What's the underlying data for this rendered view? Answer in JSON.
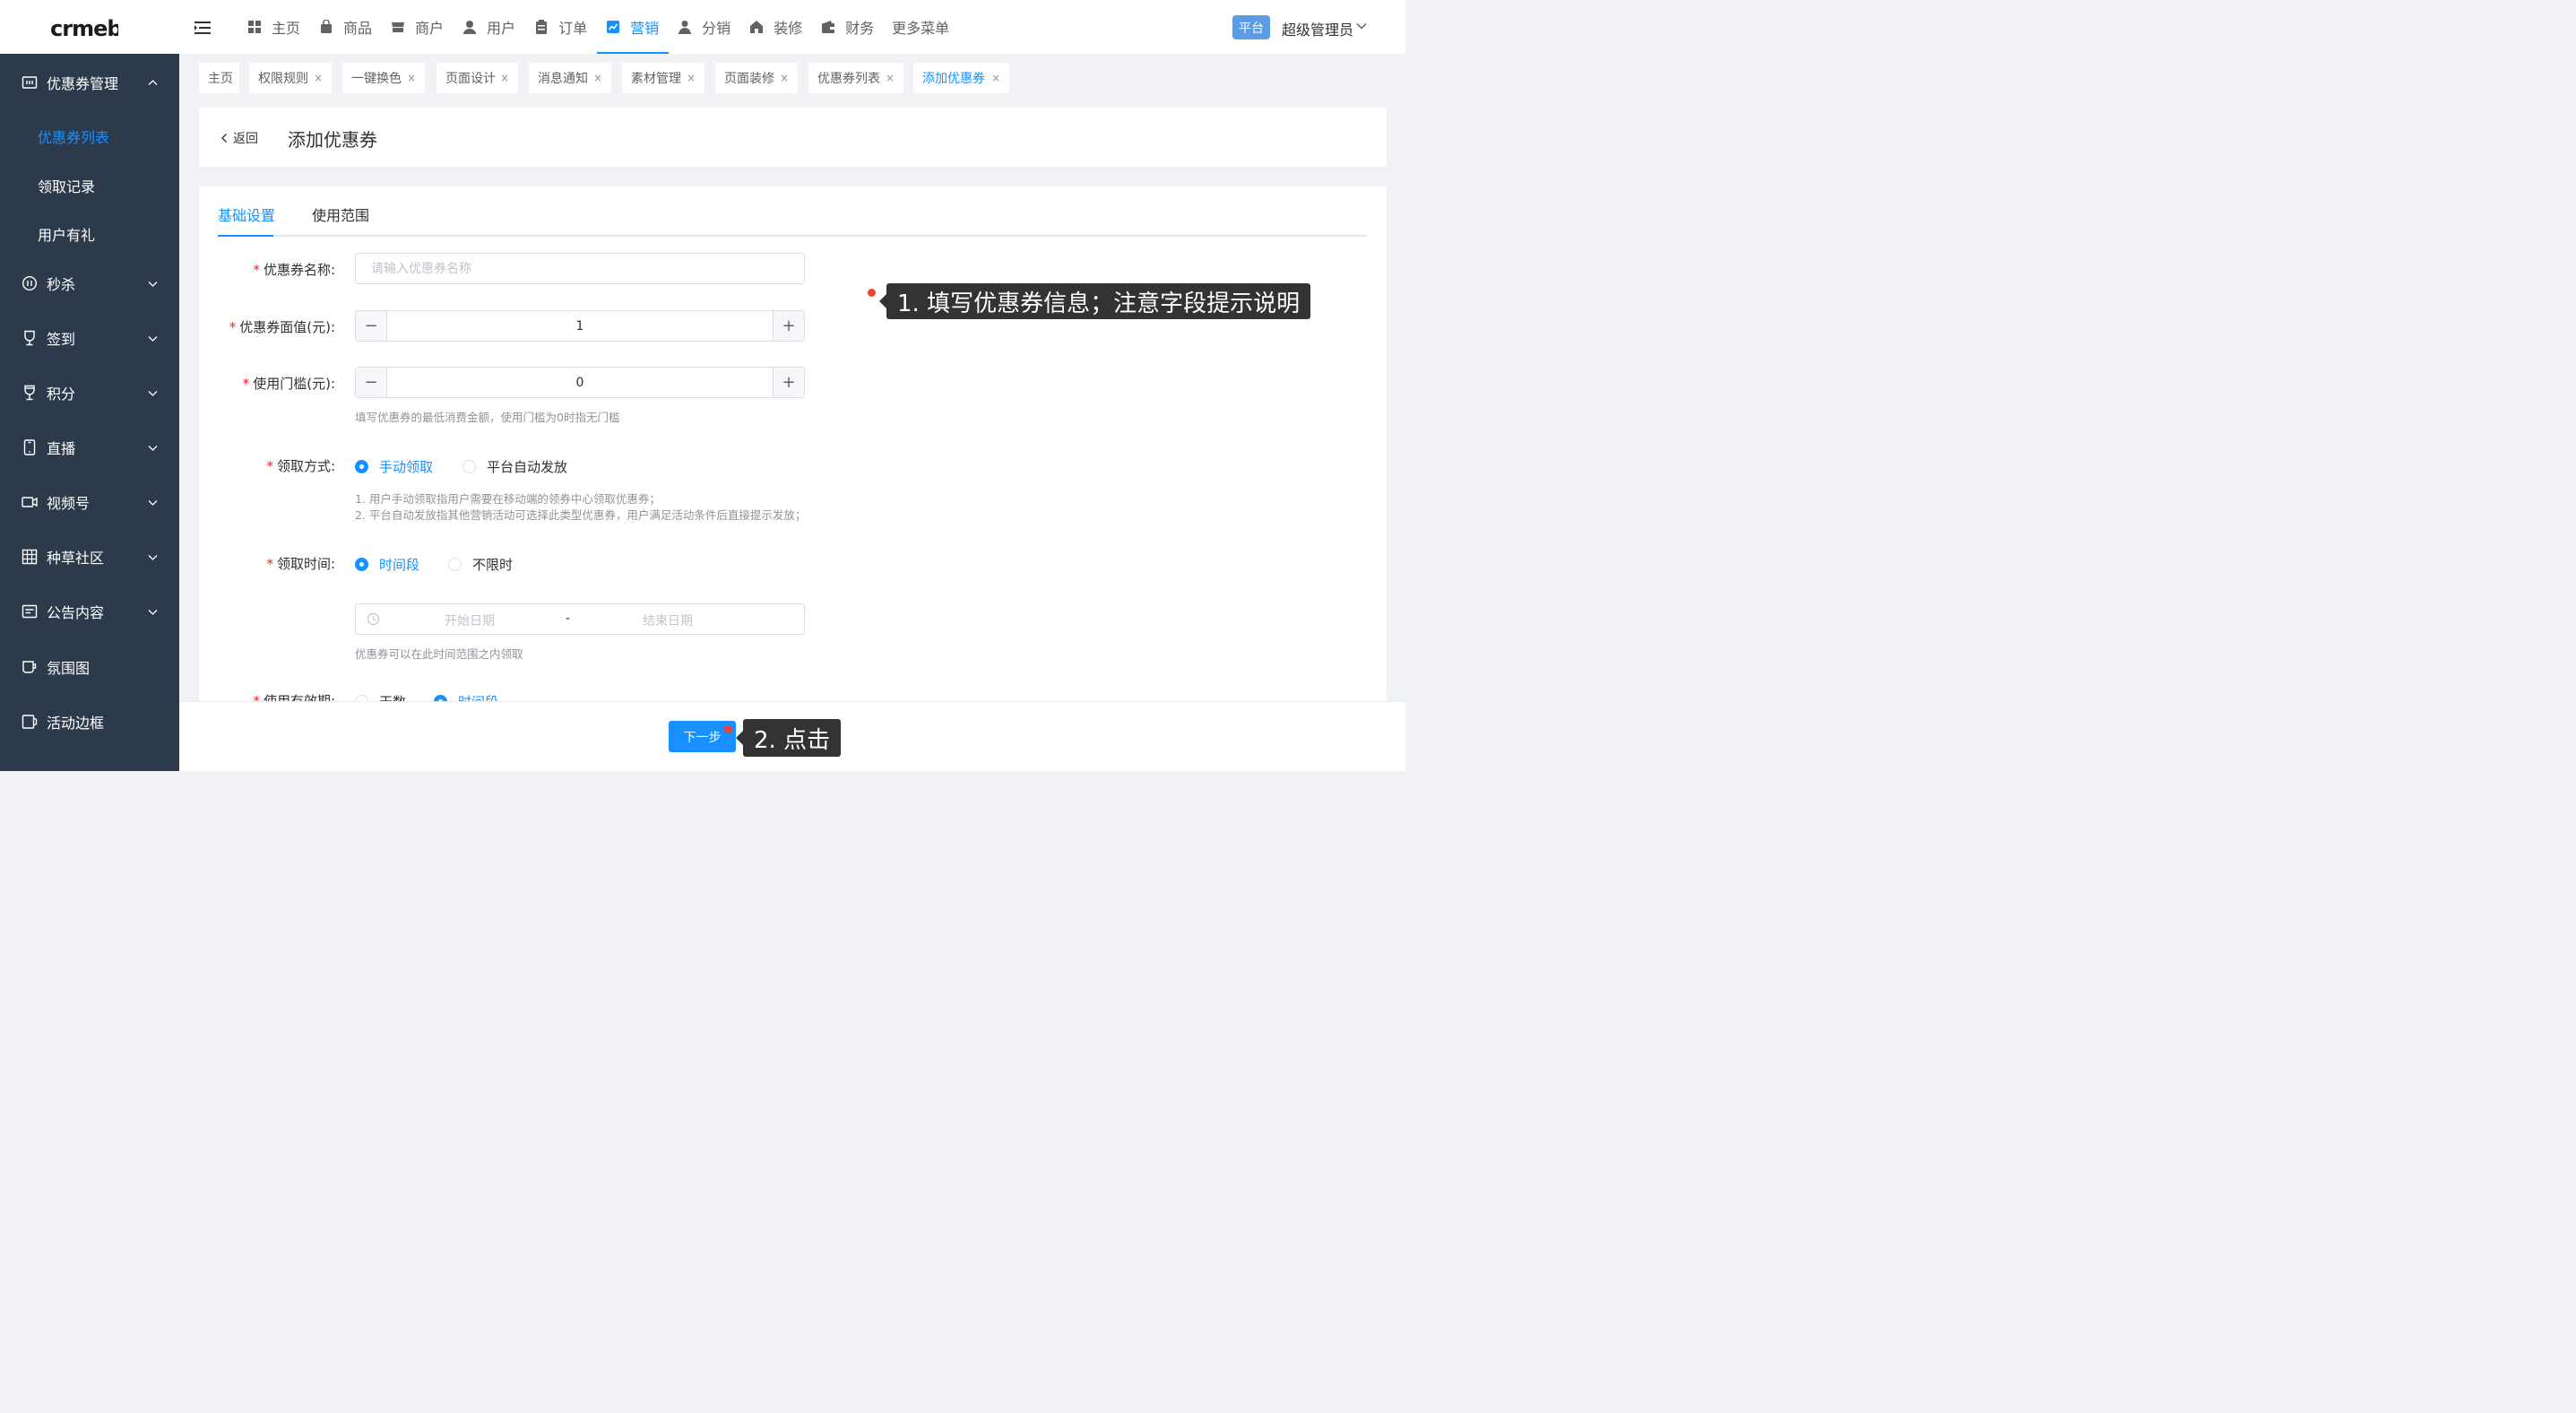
{
  "topbar": {
    "logo_text": "crmeb",
    "nav": [
      {
        "label": "主页",
        "icon": "grid-icon"
      },
      {
        "label": "商品",
        "icon": "bag-icon"
      },
      {
        "label": "商户",
        "icon": "shop-icon"
      },
      {
        "label": "用户",
        "icon": "user-icon"
      },
      {
        "label": "订单",
        "icon": "clipboard-icon"
      },
      {
        "label": "营销",
        "icon": "chart-icon",
        "active": true
      },
      {
        "label": "分销",
        "icon": "distribution-icon"
      },
      {
        "label": "装修",
        "icon": "home-icon"
      },
      {
        "label": "财务",
        "icon": "wallet-icon"
      },
      {
        "label": "更多菜单"
      }
    ],
    "platform_badge": "平台",
    "admin_name": "超级管理员"
  },
  "sidebar": {
    "groups": [
      {
        "label": "优惠券管理",
        "icon": "coupon-icon",
        "expanded": true
      },
      {
        "label": "秒杀",
        "icon": "timer-icon"
      },
      {
        "label": "签到",
        "icon": "cup-icon"
      },
      {
        "label": "积分",
        "icon": "trophy-icon"
      },
      {
        "label": "直播",
        "icon": "phone-icon"
      },
      {
        "label": "视频号",
        "icon": "video-icon"
      },
      {
        "label": "种草社区",
        "icon": "grid-table-icon"
      },
      {
        "label": "公告内容",
        "icon": "notice-icon"
      },
      {
        "label": "氛围图",
        "icon": "mug-icon"
      },
      {
        "label": "活动边框",
        "icon": "frame-icon"
      }
    ],
    "sub_items": [
      {
        "label": "优惠券列表",
        "active": true
      },
      {
        "label": "领取记录"
      },
      {
        "label": "用户有礼"
      }
    ]
  },
  "tags": [
    {
      "label": "主页",
      "closable": false
    },
    {
      "label": "权限规则",
      "closable": true
    },
    {
      "label": "一键换色",
      "closable": true
    },
    {
      "label": "页面设计",
      "closable": true
    },
    {
      "label": "消息通知",
      "closable": true
    },
    {
      "label": "素材管理",
      "closable": true
    },
    {
      "label": "页面装修",
      "closable": true
    },
    {
      "label": "优惠券列表",
      "closable": true
    },
    {
      "label": "添加优惠券",
      "closable": true,
      "active": true
    }
  ],
  "tag_close_glyph": "×",
  "header": {
    "back_label": "返回",
    "title": "添加优惠券"
  },
  "form_tabs": [
    {
      "label": "基础设置",
      "active": true
    },
    {
      "label": "使用范围"
    }
  ],
  "form": {
    "name": {
      "label": "优惠券名称:",
      "placeholder": "请输入优惠券名称",
      "value": ""
    },
    "face_value": {
      "label": "优惠券面值(元):",
      "value": "1"
    },
    "threshold": {
      "label": "使用门槛(元):",
      "value": "0",
      "hint": "填写优惠券的最低消费金额，使用门槛为0时指无门槛"
    },
    "receive_method": {
      "label": "领取方式:",
      "options": [
        "手动领取",
        "平台自动发放"
      ],
      "selected": "手动领取",
      "hint_lines": [
        "1. 用户手动领取指用户需要在移动端的领券中心领取优惠券；",
        "2. 平台自动发放指其他营销活动可选择此类型优惠券，用户满足活动条件后直接提示发放；"
      ]
    },
    "receive_time": {
      "label": "领取时间:",
      "options": [
        "时间段",
        "不限时"
      ],
      "selected": "时间段",
      "start_placeholder": "开始日期",
      "separator": "-",
      "end_placeholder": "结束日期",
      "hint": "优惠券可以在此时间范围之内领取"
    },
    "validity": {
      "label": "使用有效期:",
      "options": [
        "天数",
        "时间段"
      ],
      "selected": "时间段"
    }
  },
  "footer": {
    "next_label": "下一步"
  },
  "annotations": {
    "step1": "1. 填写优惠券信息；注意字段提示说明",
    "step2": "2. 点击"
  },
  "colors": {
    "primary": "#1890ff",
    "sidebar_bg": "#2d3a4b",
    "required": "#f5222d",
    "annotation_dot": "#f2412e",
    "annotation_bg": "#333333"
  }
}
